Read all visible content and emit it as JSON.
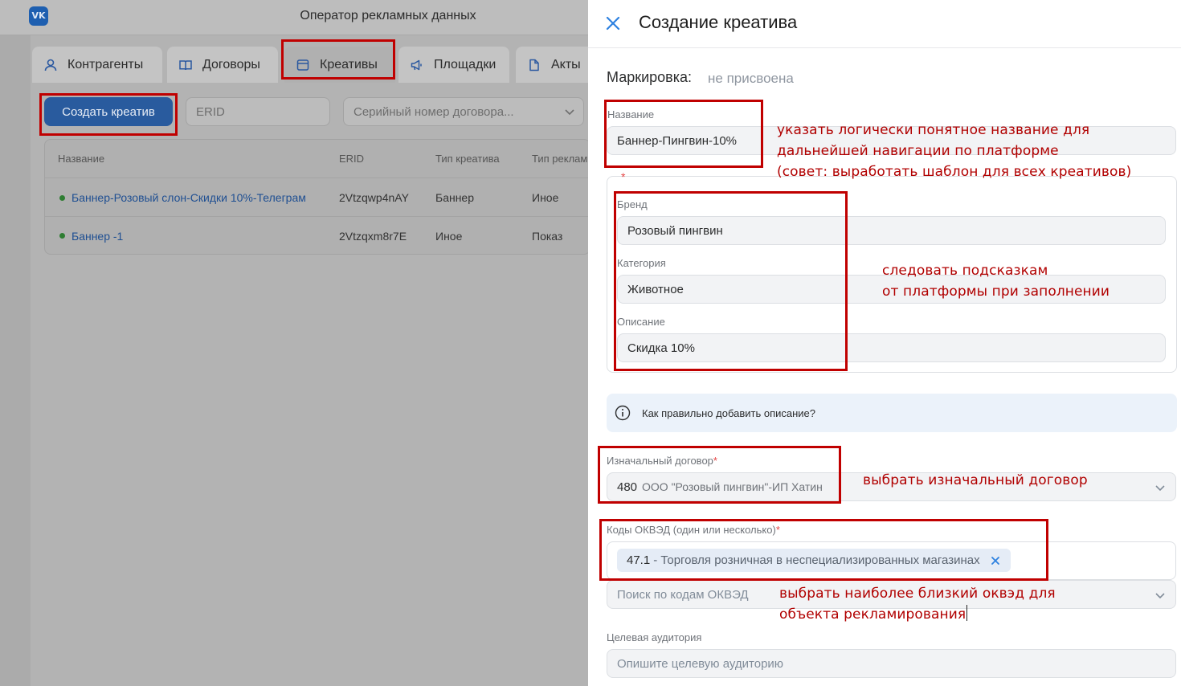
{
  "app": {
    "logo_text": "VK",
    "title": "Оператор рекламных данных"
  },
  "tabs": [
    {
      "label": "Контрагенты",
      "icon": "user-icon"
    },
    {
      "label": "Договоры",
      "icon": "book-icon"
    },
    {
      "label": "Креативы",
      "icon": "card-icon"
    },
    {
      "label": "Площадки",
      "icon": "megaphone-icon"
    },
    {
      "label": "Акты",
      "icon": "document-icon"
    }
  ],
  "toolbar": {
    "create_label": "Создать креатив",
    "erid_placeholder": "ERID",
    "contract_placeholder": "Серийный номер договора..."
  },
  "table": {
    "headers": [
      "Название",
      "ERID",
      "Тип креатива",
      "Тип реклам"
    ],
    "rows": [
      {
        "name": "Баннер-Розовый слон-Скидки 10%-Телеграм",
        "erid": "2Vtzqwp4nAY",
        "type": "Баннер",
        "ad_type": "Иное",
        "status_color": "#2e7d32"
      },
      {
        "name": "Баннер -1",
        "erid": "2Vtzqxm8r7E",
        "type": "Иное",
        "ad_type": "Показ",
        "status_color": "#2e7d32"
      }
    ]
  },
  "panel": {
    "title": "Создание креатива",
    "marking_label": "Маркировка:",
    "marking_value": "не присвоена",
    "name_label": "Название",
    "name_value": "Баннер-Пингвин-10%",
    "group_required_mark": "*",
    "brand_label": "Бренд",
    "brand_value": "Розовый пингвин",
    "category_label": "Категория",
    "category_value": "Животное",
    "description_label": "Описание",
    "description_value": "Скидка 10%",
    "info_text": "Как правильно добавить описание?",
    "contract_label": "Изначальный договор",
    "contract_number": "480",
    "contract_desc": "ООО \"Розовый пингвин\"-ИП Хатин",
    "okved_label": "Коды ОКВЭД (один или несколько)",
    "okved_chip_code": "47.1",
    "okved_chip_desc": "- Торговля розничная в неспециализированных магазинах",
    "okved_search_placeholder": "Поиск по кодам ОКВЭД",
    "audience_label": "Целевая аудитория",
    "audience_placeholder": "Опишите целевую аудиторию",
    "required_mark": "*"
  },
  "notes": {
    "name_line1": "указать логически понятное название для",
    "name_line2": "дальнейшей навигации по платформе",
    "name_line3": "(совет: выработать шаблон для всех креативов)",
    "hints_line1": "следовать подсказкам",
    "hints_line2": "от платформы при заполнении",
    "contract_note": "выбрать изначальный договор",
    "okved_line1": "выбрать наиболее близкий оквэд для",
    "okved_line2": "объекта рекламирования"
  },
  "colors": {
    "primary": "#2d81e0",
    "annotation_red": "#c00000",
    "status_green": "#2e7d32",
    "info_bg": "#ebf2fa"
  }
}
